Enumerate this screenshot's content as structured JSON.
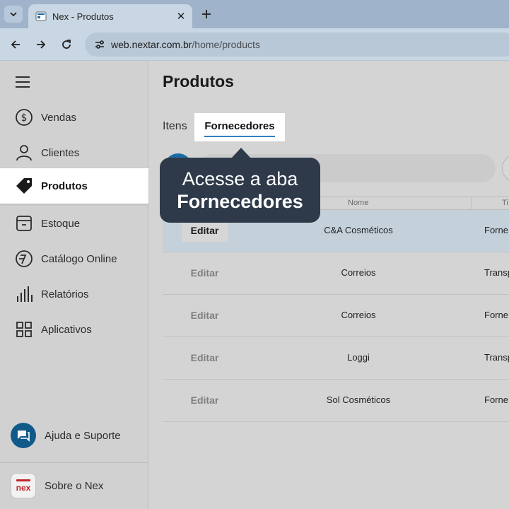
{
  "browser": {
    "tab_title": "Nex - Produtos",
    "close_symbol": "✕",
    "url_host": "web.nextar.com.br",
    "url_path": "/home/products"
  },
  "sidebar": {
    "items": [
      {
        "label": "Vendas",
        "icon": "dollar-circle-icon"
      },
      {
        "label": "Clientes",
        "icon": "person-icon"
      },
      {
        "label": "Produtos",
        "icon": "tag-icon",
        "active": true
      },
      {
        "label": "Estoque",
        "icon": "box-icon"
      },
      {
        "label": "Catálogo Online",
        "icon": "catalog-icon"
      },
      {
        "label": "Relatórios",
        "icon": "bar-chart-icon"
      },
      {
        "label": "Aplicativos",
        "icon": "grid-icon"
      }
    ],
    "help_label": "Ajuda e Suporte",
    "about_label": "Sobre o Nex",
    "about_logo_text": "nex"
  },
  "main": {
    "title": "Produtos",
    "tabs": [
      {
        "label": "Itens"
      },
      {
        "label": "Fornecedores",
        "active": true
      }
    ],
    "table": {
      "headers": {
        "nome": "Nome",
        "tipo": "Ti"
      },
      "edit_label": "Editar",
      "rows": [
        {
          "nome": "C&A Cosméticos",
          "tipo": "Forne",
          "highlight": true
        },
        {
          "nome": "Correios",
          "tipo": "Transpo"
        },
        {
          "nome": "Correios",
          "tipo": "Forne"
        },
        {
          "nome": "Loggi",
          "tipo": "Transpo"
        },
        {
          "nome": "Sol Cosméticos",
          "tipo": "Forne"
        }
      ]
    }
  },
  "callout": {
    "line1": "Acesse a aba",
    "line2": "Fornecedores"
  },
  "colors": {
    "accent": "#1a6aa4",
    "callout_bg": "#2e3a4a",
    "highlight_row": "#c4d1db",
    "brand_red": "#c4262e"
  }
}
